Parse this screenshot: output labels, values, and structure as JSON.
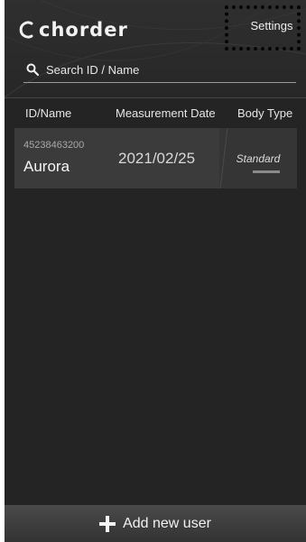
{
  "header": {
    "logo_text": "chorder",
    "settings_label": "Settings"
  },
  "search": {
    "placeholder": "Search ID / Name"
  },
  "columns": {
    "id_name": "ID/Name",
    "measurement_date": "Measurement Date",
    "body_type": "Body Type"
  },
  "users": [
    {
      "id": "45238463200",
      "name": "Aurora",
      "measurement_date": "2021/02/25",
      "body_type": "Standard"
    }
  ],
  "footer": {
    "add_label": "Add new user"
  },
  "icons": {
    "logo": "logo-mark-icon",
    "search": "search-icon",
    "add": "plus-icon"
  },
  "colors": {
    "background": "#242424",
    "row": "#3b3b3b",
    "text": "#f2f2f2"
  }
}
